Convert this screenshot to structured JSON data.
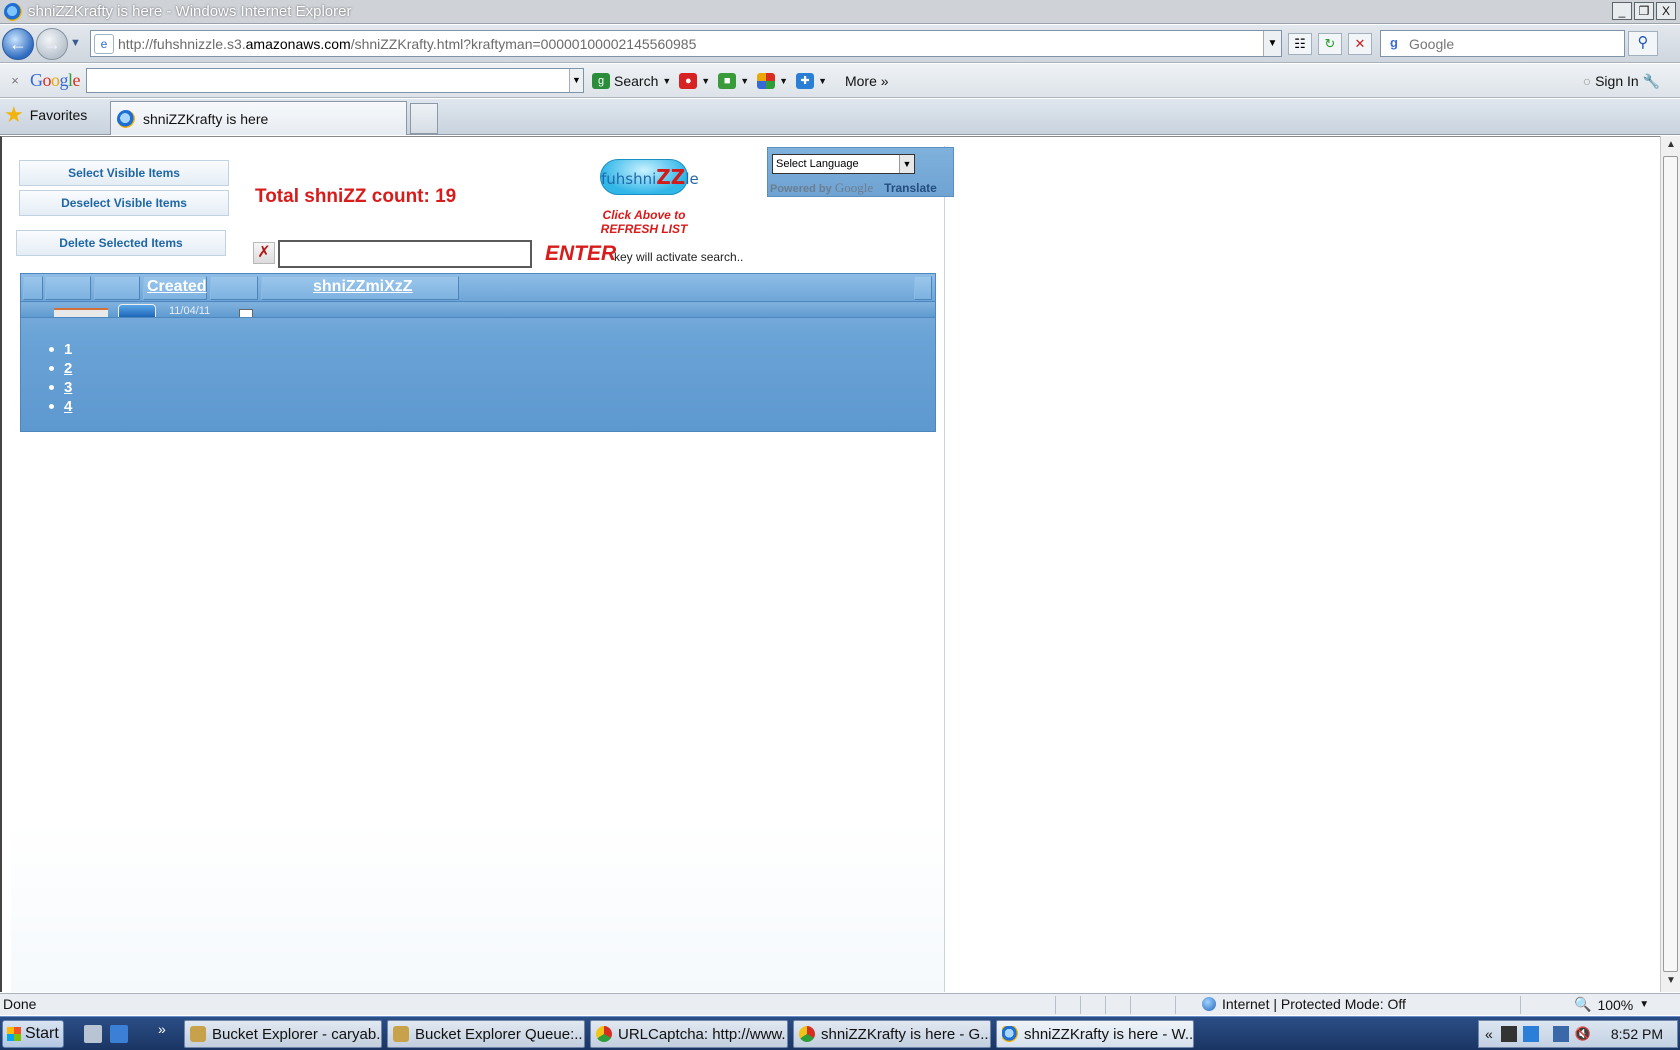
{
  "window": {
    "title": "shniZZKrafty is here - Windows Internet Explorer",
    "controls": [
      "_",
      "❐",
      "X"
    ]
  },
  "address_bar": {
    "url_prefix": "http://fuhshnizzle.s3.",
    "url_domain": "amazonaws.com",
    "url_suffix": "/shniZZKrafty.html?kraftyman=00000100002145560985",
    "search_placeholder": "Google"
  },
  "google_toolbar": {
    "close": "×",
    "logo": "Google",
    "search_label": "Search",
    "more_label": "More »",
    "sign_in": "Sign In"
  },
  "favorites_bar": {
    "favorites_label": "Favorites",
    "tab_title": "shniZZKrafty is here"
  },
  "page": {
    "select_visible": "Select Visible Items",
    "deselect_visible": "Deselect Visible Items",
    "delete_selected": "Delete Selected Items",
    "count_label": "Total shniZZ count: 19",
    "logo_prefix": "fuhshni",
    "logo_zz": "ZZ",
    "logo_suffix": "le",
    "refresh_note_1": "Click Above to",
    "refresh_note_2": "REFRESH LIST",
    "language_select": "Select Language",
    "powered_by": "Powered by",
    "google_word": "Google",
    "translate": "Translate",
    "clear_symbol": "✗",
    "enter_word": "ENTER",
    "enter_note": "key will activate search..",
    "column_created": "Created",
    "column_mix": "shniZZmiXzZ",
    "date_peek": "11/04/11",
    "pages": [
      "1",
      "2",
      "3",
      "4"
    ]
  },
  "status_bar": {
    "status": "Done",
    "zone": "Internet | Protected Mode: Off",
    "zoom": "100%"
  },
  "taskbar": {
    "start": "Start",
    "tasks": [
      "Bucket Explorer - caryab...",
      "Bucket Explorer Queue:...",
      "URLCaptcha: http://www....",
      "shniZZKrafty is here - G...",
      "shniZZKrafty is here - W..."
    ],
    "clock": "8:52 PM"
  },
  "colors": {
    "accent_red": "#d81b1b",
    "grid_blue": "#6aa3d6",
    "button_text": "#1f66a3"
  }
}
